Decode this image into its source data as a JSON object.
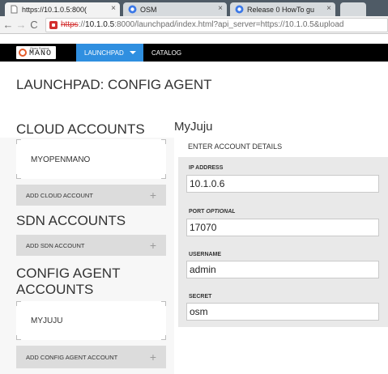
{
  "browser": {
    "tabs": [
      {
        "label": "https://10.1.0.5:800(",
        "active": true,
        "icon": "page-icon"
      },
      {
        "label": "OSM",
        "active": false,
        "icon": "chrome-icon"
      },
      {
        "label": "Release 0 HowTo gu",
        "active": false,
        "icon": "chrome-icon"
      }
    ],
    "url": {
      "protocol": "https",
      "separator": "://",
      "host": "10.1.0.5",
      "rest": ":8000/launchpad/index.html?api_server=https://10.1.0.5&upload"
    }
  },
  "appnav": {
    "logo_sub": "Open Source",
    "logo_word": "MANO",
    "launchpad_label": "LAUNCHPAD",
    "catalog_label": "CATALOG",
    "accent": "#2f8fe0"
  },
  "page": {
    "heading": "LAUNCHPAD: CONFIG AGENT"
  },
  "cloud": {
    "title": "CLOUD ACCOUNTS",
    "items": [
      "MYOPENMANO"
    ],
    "add_label": "ADD CLOUD ACCOUNT"
  },
  "sdn": {
    "title": "SDN ACCOUNTS",
    "add_label": "ADD SDN ACCOUNT"
  },
  "config": {
    "title_line1": "CONFIG AGENT",
    "title_line2": "ACCOUNTS",
    "items": [
      "MYJUJU"
    ],
    "add_label": "ADD CONFIG AGENT ACCOUNT"
  },
  "details": {
    "account_name": "MyJuju",
    "header": "ENTER ACCOUNT DETAILS",
    "fields": {
      "ip": {
        "label": "IP ADDRESS",
        "value": "10.1.0.6"
      },
      "port": {
        "label": "PORT",
        "optional": "OPTIONAL",
        "value": "17070"
      },
      "username": {
        "label": "USERNAME",
        "value": "admin"
      },
      "secret": {
        "label": "SECRET",
        "value": "osm"
      }
    }
  },
  "icons": {
    "plus": "+",
    "back": "←",
    "forward": "→",
    "reload": "C",
    "close": "×"
  }
}
